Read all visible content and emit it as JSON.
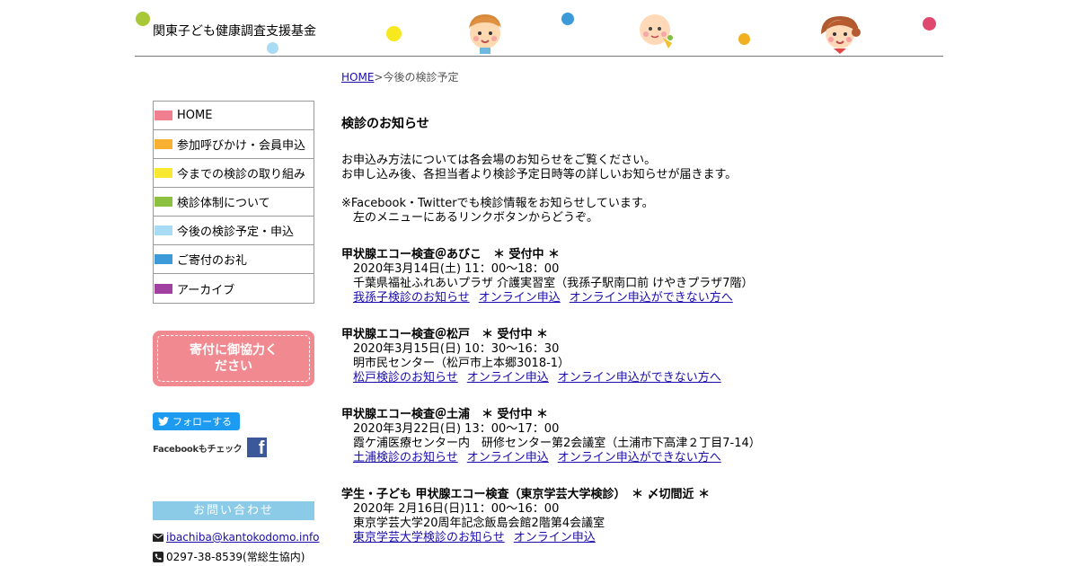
{
  "header": {
    "site_title": "関東子ども健康調査支援基金"
  },
  "breadcrumb": {
    "home": "HOME",
    "separator": ">",
    "current": "今後の検診予定"
  },
  "menu": [
    {
      "label": "HOME",
      "color": "#f08090"
    },
    {
      "label": "参加呼びかけ・会員申込",
      "color": "#f8b030"
    },
    {
      "label": "今までの検診の取り組み",
      "color": "#f8e830"
    },
    {
      "label": "検診体制について",
      "color": "#8cc040"
    },
    {
      "label": "今後の検診予定・申込",
      "color": "#a8dcf5"
    },
    {
      "label": "ご寄付のお礼",
      "color": "#3c9ad8"
    },
    {
      "label": "アーカイブ",
      "color": "#a040a0"
    }
  ],
  "donate": {
    "label": "寄付に御協力ください"
  },
  "social": {
    "twitter": "フォローする",
    "facebook": "Facebookもチェック"
  },
  "contact": {
    "title": "お問い合わせ",
    "email": "ibachiba@kantokodomo.info",
    "phone": "0297-38-8539(常総生協内)"
  },
  "main": {
    "title": "検診のお知らせ",
    "intro1": "お申込み方法については各会場のお知らせをご覧ください。",
    "intro2": "お申し込み後、各担当者より検診予定日時等の詳しいお知らせが届きます。",
    "intro3": "※Facebook・Twitterでも検診情報をお知らせしています。",
    "intro4": "左のメニューにあるリンクボタンからどうぞ。",
    "events": [
      {
        "title": "甲状腺エコー検査＠あびこ　＊ 受付中 ＊",
        "date": "2020年3月14日(土) 11：00～18：00",
        "place": "千葉県福祉ふれあいプラザ 介護実習室（我孫子駅南口前 けやきプラザ7階）",
        "link1": "我孫子検診のお知らせ",
        "link2": "オンライン申込",
        "link3": "オンライン申込ができない方へ"
      },
      {
        "title": "甲状腺エコー検査＠松戸　＊ 受付中 ＊",
        "date": "2020年3月15日(日) 10：30～16：30",
        "place": "明市民センター（松戸市上本郷3018-1）",
        "link1": "松戸検診のお知らせ",
        "link2": "オンライン申込",
        "link3": "オンライン申込ができない方へ"
      },
      {
        "title": "甲状腺エコー検査＠土浦　＊ 受付中 ＊",
        "date": "2020年3月22日(日) 13：00～17：00",
        "place": "霞ケ浦医療センター内　研修センター第2会議室（土浦市下高津２丁目7-14）",
        "link1": "土浦検診のお知らせ",
        "link2": "オンライン申込",
        "link3": "オンライン申込ができない方へ"
      },
      {
        "title": "学生・子ども 甲状腺エコー検査（東京学芸大学検診）　＊ 〆切間近 ＊",
        "date": "2020年 2月16日(日)11：00～16：00",
        "place": "東京学芸大学20周年記念飯島会館2階第4会議室",
        "link1": "東京学芸大学検診のお知らせ",
        "link2": "オンライン申込"
      }
    ]
  }
}
